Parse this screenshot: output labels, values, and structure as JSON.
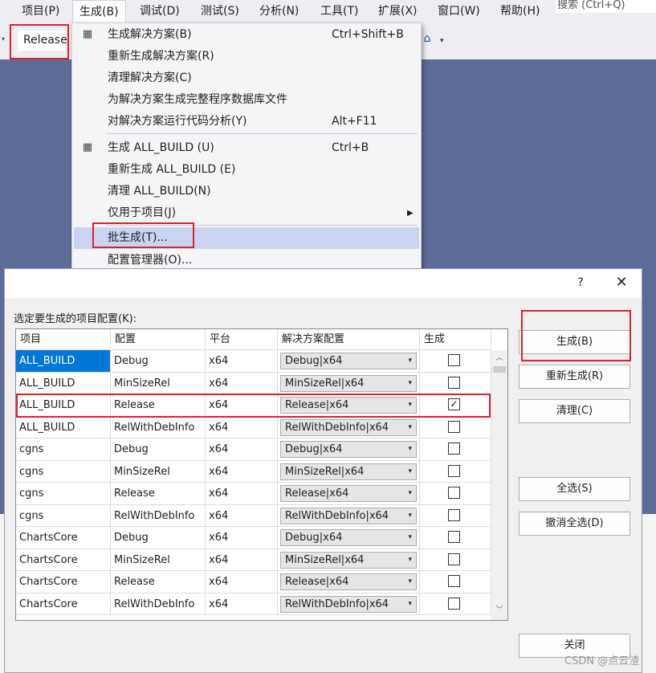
{
  "menubar": {
    "items": [
      "项目(P)",
      "生成(B)",
      "调试(D)",
      "测试(S)",
      "分析(N)",
      "工具(T)",
      "扩展(X)",
      "窗口(W)",
      "帮助(H)"
    ],
    "search_placeholder": "搜索 (Ctrl+Q)"
  },
  "toolbar": {
    "configuration": "Release"
  },
  "build_menu": {
    "group1": [
      {
        "label": "生成解决方案(B)",
        "shortcut": "Ctrl+Shift+B"
      },
      {
        "label": "重新生成解决方案(R)",
        "shortcut": ""
      },
      {
        "label": "清理解决方案(C)",
        "shortcut": ""
      },
      {
        "label": "为解决方案生成完整程序数据库文件",
        "shortcut": ""
      },
      {
        "label": "对解决方案运行代码分析(Y)",
        "shortcut": "Alt+F11"
      }
    ],
    "group2": [
      {
        "label": "生成 ALL_BUILD (U)",
        "shortcut": "Ctrl+B"
      },
      {
        "label": "重新生成 ALL_BUILD (E)",
        "shortcut": ""
      },
      {
        "label": "清理 ALL_BUILD(N)",
        "shortcut": ""
      },
      {
        "label": "仅用于项目(J)",
        "shortcut": ""
      }
    ],
    "group3": [
      {
        "label": "批生成(T)...",
        "shortcut": ""
      },
      {
        "label": "配置管理器(O)...",
        "shortcut": ""
      }
    ]
  },
  "dialog": {
    "help": "?",
    "close": "✕",
    "caption": "选定要生成的项目配置(K):",
    "columns": [
      "项目",
      "配置",
      "平台",
      "解决方案配置",
      "生成"
    ],
    "rows": [
      {
        "project": "ALL_BUILD",
        "config": "Debug",
        "platform": "x64",
        "solution_config": "Debug|x64",
        "build": false
      },
      {
        "project": "ALL_BUILD",
        "config": "MinSizeRel",
        "platform": "x64",
        "solution_config": "MinSizeRel|x64",
        "build": false
      },
      {
        "project": "ALL_BUILD",
        "config": "Release",
        "platform": "x64",
        "solution_config": "Release|x64",
        "build": true
      },
      {
        "project": "ALL_BUILD",
        "config": "RelWithDebInfo",
        "platform": "x64",
        "solution_config": "RelWithDebInfo|x64",
        "build": false
      },
      {
        "project": "cgns",
        "config": "Debug",
        "platform": "x64",
        "solution_config": "Debug|x64",
        "build": false
      },
      {
        "project": "cgns",
        "config": "MinSizeRel",
        "platform": "x64",
        "solution_config": "MinSizeRel|x64",
        "build": false
      },
      {
        "project": "cgns",
        "config": "Release",
        "platform": "x64",
        "solution_config": "Release|x64",
        "build": false
      },
      {
        "project": "cgns",
        "config": "RelWithDebInfo",
        "platform": "x64",
        "solution_config": "RelWithDebInfo|x64",
        "build": false
      },
      {
        "project": "ChartsCore",
        "config": "Debug",
        "platform": "x64",
        "solution_config": "Debug|x64",
        "build": false
      },
      {
        "project": "ChartsCore",
        "config": "MinSizeRel",
        "platform": "x64",
        "solution_config": "MinSizeRel|x64",
        "build": false
      },
      {
        "project": "ChartsCore",
        "config": "Release",
        "platform": "x64",
        "solution_config": "Release|x64",
        "build": false
      },
      {
        "project": "ChartsCore",
        "config": "RelWithDebInfo",
        "platform": "x64",
        "solution_config": "RelWithDebInfo|x64",
        "build": false
      }
    ],
    "buttons": {
      "build": "生成(B)",
      "rebuild": "重新生成(R)",
      "clean": "清理(C)",
      "select_all": "全选(S)",
      "deselect_all": "撤消全选(D)",
      "close": "关闭"
    }
  },
  "watermark": "CSDN @点云渣",
  "colors": {
    "highlight": "#c9d4f2",
    "selection": "#0078d7",
    "annotation_red": "#e0212b",
    "ide_background": "#5d6b99"
  }
}
